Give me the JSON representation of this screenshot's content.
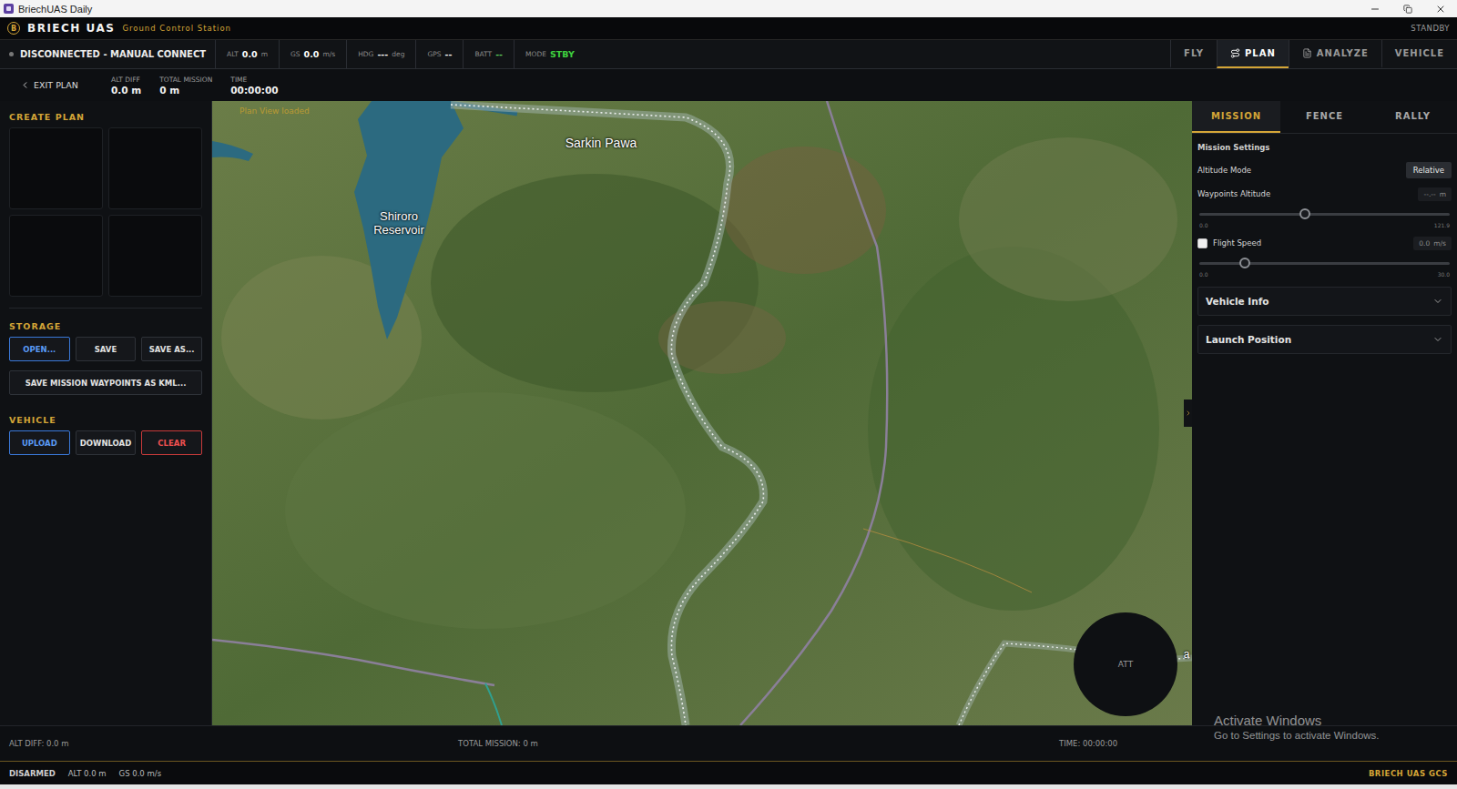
{
  "window": {
    "title": "BriechUAS Daily"
  },
  "header": {
    "logo": "B",
    "brand": "BRIECH UAS",
    "subtitle": "Ground Control Station",
    "status": "STANDBY"
  },
  "telemetry": {
    "connection": "DISCONNECTED - MANUAL CONNECT",
    "items": [
      {
        "label": "ALT",
        "value": "0.0",
        "unit": "m",
        "color": "#ffffff"
      },
      {
        "label": "GS",
        "value": "0.0",
        "unit": "m/s",
        "color": "#ffffff"
      },
      {
        "label": "HDG",
        "value": "---",
        "unit": "deg",
        "color": "#ffffff"
      },
      {
        "label": "GPS",
        "value": "--",
        "color": "#ffffff"
      },
      {
        "label": "BATT",
        "value": "--",
        "color": "#5fd35f"
      },
      {
        "label": "MODE",
        "value": "STBY",
        "color": "#3fd13f"
      }
    ]
  },
  "nav": [
    {
      "label": "FLY",
      "selected": false
    },
    {
      "label": "PLAN",
      "selected": true
    },
    {
      "label": "ANALYZE",
      "selected": false
    },
    {
      "label": "VEHICLE",
      "selected": false
    }
  ],
  "plan_bar": {
    "exit": "EXIT PLAN",
    "stats": [
      {
        "label": "ALT DIFF",
        "value": "0.0 m"
      },
      {
        "label": "TOTAL MISSION",
        "value": "0 m"
      },
      {
        "label": "TIME",
        "value": "00:00:00"
      }
    ]
  },
  "create_plan": {
    "title": "CREATE PLAN",
    "tiles": [
      {
        "empty": true
      },
      {
        "empty": true
      },
      {
        "empty": true
      },
      {
        "empty": true
      }
    ]
  },
  "storage": {
    "title": "STORAGE",
    "buttons": [
      {
        "label": "OPEN...",
        "kind": "primary"
      },
      {
        "label": "SAVE",
        "kind": "default"
      },
      {
        "label": "SAVE AS...",
        "kind": "default"
      }
    ],
    "kml": "SAVE MISSION WAYPOINTS AS KML..."
  },
  "vehicle": {
    "title": "VEHICLE",
    "buttons": [
      {
        "label": "UPLOAD",
        "kind": "primary"
      },
      {
        "label": "DOWNLOAD",
        "kind": "default"
      },
      {
        "label": "CLEAR",
        "kind": "danger"
      }
    ]
  },
  "map": {
    "status": "Plan View loaded",
    "labels": [
      {
        "text": "Sarkin Pawa"
      },
      {
        "text": "Shiroro Reservoir"
      },
      {
        "text": "a"
      }
    ],
    "attitude": "ATT"
  },
  "right_panel": {
    "tabs": [
      {
        "label": "MISSION",
        "selected": true
      },
      {
        "label": "FENCE",
        "selected": false
      },
      {
        "label": "RALLY",
        "selected": false
      }
    ],
    "settings_title": "Mission Settings",
    "altitude_mode": {
      "label": "Altitude Mode",
      "value": "Relative"
    },
    "waypoints_altitude": {
      "label": "Waypoints Altitude",
      "value": "--.--",
      "unit": "m",
      "level": 0.42,
      "min": "0.0",
      "max": "121.9"
    },
    "flight_speed": {
      "label": "Flight Speed",
      "checked": false,
      "value": "0.0",
      "unit": "m/s",
      "level": 0.18,
      "min": "0.0",
      "max": "30.0"
    },
    "sections": [
      {
        "label": "Vehicle Info",
        "expanded": false
      },
      {
        "label": "Launch Position",
        "expanded": false
      }
    ]
  },
  "watermark": {
    "title": "Activate Windows",
    "text": "Go to Settings to activate Windows."
  },
  "summary": [
    "ALT DIFF: 0.0 m",
    "TOTAL MISSION: 0 m",
    "TIME: 00:00:00"
  ],
  "footer": {
    "state": "DISARMED",
    "items": [
      "ALT 0.0 m",
      "GS 0.0 m/s"
    ],
    "brand": "BRIECH UAS GCS"
  }
}
